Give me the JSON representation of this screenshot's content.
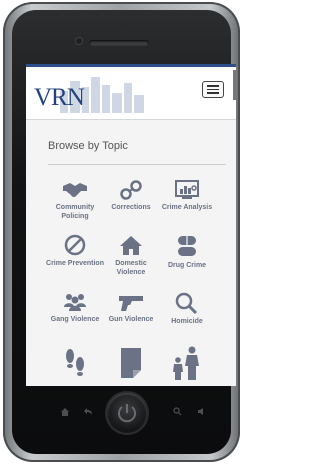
{
  "app": {
    "logo_text": "VRN"
  },
  "browse": {
    "title": "Browse by Topic"
  },
  "topics": [
    {
      "label": "Community Policing",
      "icon": "handshake-icon"
    },
    {
      "label": "Corrections",
      "icon": "handcuffs-icon"
    },
    {
      "label": "Crime Analysis",
      "icon": "chart-monitor-icon"
    },
    {
      "label": "Crime Prevention",
      "icon": "prohibited-icon"
    },
    {
      "label": "Domestic Violence",
      "icon": "house-icon"
    },
    {
      "label": "Drug Crime",
      "icon": "pills-icon"
    },
    {
      "label": "Gang Violence",
      "icon": "group-icon"
    },
    {
      "label": "Gun Violence",
      "icon": "handgun-icon"
    },
    {
      "label": "Homicide",
      "icon": "magnifier-icon"
    },
    {
      "label": "",
      "icon": "footprints-icon"
    },
    {
      "label": "",
      "icon": "document-icon"
    },
    {
      "label": "",
      "icon": "family-icon"
    }
  ],
  "colors": {
    "brand": "#23437c",
    "icon": "#6b7285",
    "accent_bar": "#2e4f8a"
  }
}
